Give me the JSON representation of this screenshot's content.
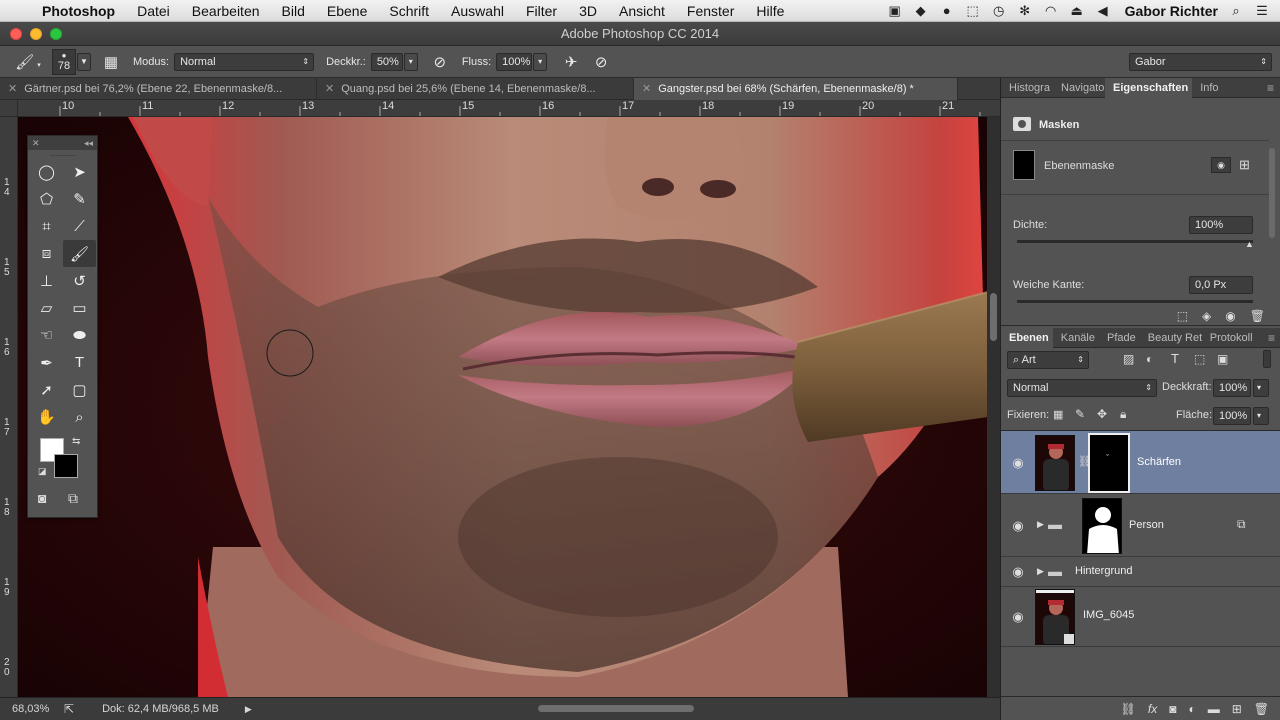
{
  "mac_menubar": {
    "apple_icon": "apple-icon",
    "app_name": "Photoshop",
    "menus": [
      "Datei",
      "Bearbeiten",
      "Bild",
      "Ebene",
      "Schrift",
      "Auswahl",
      "Filter",
      "3D",
      "Ansicht",
      "Fenster",
      "Hilfe"
    ],
    "user_name": "Gabor Richter"
  },
  "window": {
    "title": "Adobe Photoshop CC 2014"
  },
  "options_bar": {
    "brush_size": "78",
    "mode_label": "Modus:",
    "mode_value": "Normal",
    "opacity_label": "Deckkr.:",
    "opacity_value": "50%",
    "flow_label": "Fluss:",
    "flow_value": "100%",
    "workspace": "Gabor"
  },
  "doc_tabs": [
    {
      "label": "Gärtner.psd bei 76,2% (Ebene 22, Ebenenmaske/8...",
      "active": false
    },
    {
      "label": "Quang.psd bei 25,6% (Ebene 14, Ebenenmaske/8...",
      "active": false
    },
    {
      "label": "Gangster.psd bei 68% (Schärfen, Ebenenmaske/8) *",
      "active": true
    }
  ],
  "ruler": {
    "h_ticks": [
      "10",
      "11",
      "12",
      "13",
      "14",
      "15",
      "16",
      "17",
      "18",
      "19",
      "20",
      "21"
    ],
    "v_ticks": [
      "1 4",
      "1 5",
      "1 6",
      "1 7",
      "1 8",
      "1 9",
      "2 0"
    ]
  },
  "status_bar": {
    "zoom": "68,03%",
    "doc_info": "Dok: 62,4 MB/968,5 MB"
  },
  "properties_panel": {
    "tabs": [
      "Histogra",
      "Navigato",
      "Eigenschaften",
      "Info"
    ],
    "active_tab": "Eigenschaften",
    "section_title": "Masken",
    "mask_label": "Ebenenmaske",
    "density_label": "Dichte:",
    "density_value": "100%",
    "feather_label": "Weiche Kante:",
    "feather_value": "0,0 Px"
  },
  "layers_panel": {
    "tabs": [
      "Ebenen",
      "Kanäle",
      "Pfade",
      "Beauty Ret",
      "Protokoll"
    ],
    "active_tab": "Ebenen",
    "filter_kind": "Art",
    "blend_mode": "Normal",
    "opacity_label": "Deckkraft:",
    "opacity_value": "100%",
    "lock_label": "Fixieren:",
    "fill_label": "Fläche:",
    "fill_value": "100%",
    "layers": [
      {
        "name": "Schärfen",
        "selected": true
      },
      {
        "name": "Person",
        "selected": false
      },
      {
        "name": "Hintergrund",
        "selected": false
      },
      {
        "name": "IMG_6045",
        "selected": false
      }
    ]
  },
  "colors": {
    "accent_selected_layer": "#6f7fa0",
    "panel_bg": "#535353",
    "canvas_red": "#c81d24"
  }
}
